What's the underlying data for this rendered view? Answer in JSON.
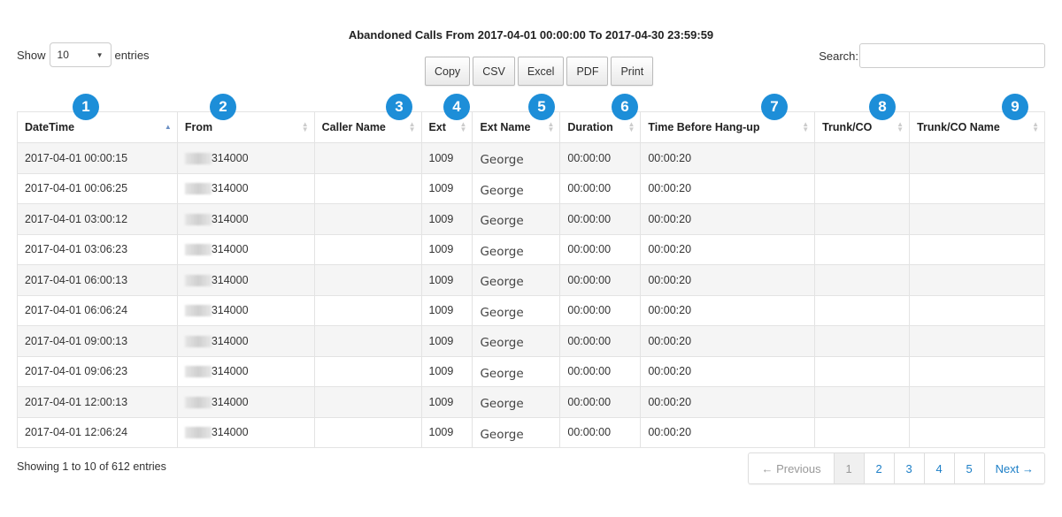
{
  "title": "Abandoned Calls From 2017-04-01 00:00:00 To 2017-04-30 23:59:59",
  "length": {
    "show_label": "Show",
    "value": "10",
    "entries_label": "entries"
  },
  "buttons": [
    "Copy",
    "CSV",
    "Excel",
    "PDF",
    "Print"
  ],
  "search": {
    "label": "Search:",
    "value": "",
    "placeholder": ""
  },
  "badge_color": "#1d8ed8",
  "columns": [
    {
      "label": "DateTime",
      "badge": "1",
      "sort": "asc"
    },
    {
      "label": "From",
      "badge": "2",
      "sort": "none"
    },
    {
      "label": "Caller Name",
      "badge": "3",
      "sort": "none"
    },
    {
      "label": "Ext",
      "badge": "4",
      "sort": "none"
    },
    {
      "label": "Ext Name",
      "badge": "5",
      "sort": "none"
    },
    {
      "label": "Duration",
      "badge": "6",
      "sort": "none"
    },
    {
      "label": "Time Before Hang-up",
      "badge": "7",
      "sort": "none"
    },
    {
      "label": "Trunk/CO",
      "badge": "8",
      "sort": "none"
    },
    {
      "label": "Trunk/CO Name",
      "badge": "9",
      "sort": "none"
    }
  ],
  "rows": [
    {
      "datetime": "2017-04-01 00:00:15",
      "from": "314000",
      "caller_name": "",
      "ext": "1009",
      "ext_name": "George",
      "duration": "00:00:00",
      "hangup": "00:00:20",
      "trunk": "",
      "trunk_name": ""
    },
    {
      "datetime": "2017-04-01 00:06:25",
      "from": "314000",
      "caller_name": "",
      "ext": "1009",
      "ext_name": "George",
      "duration": "00:00:00",
      "hangup": "00:00:20",
      "trunk": "",
      "trunk_name": ""
    },
    {
      "datetime": "2017-04-01 03:00:12",
      "from": "314000",
      "caller_name": "",
      "ext": "1009",
      "ext_name": "George",
      "duration": "00:00:00",
      "hangup": "00:00:20",
      "trunk": "",
      "trunk_name": ""
    },
    {
      "datetime": "2017-04-01 03:06:23",
      "from": "314000",
      "caller_name": "",
      "ext": "1009",
      "ext_name": "George",
      "duration": "00:00:00",
      "hangup": "00:00:20",
      "trunk": "",
      "trunk_name": ""
    },
    {
      "datetime": "2017-04-01 06:00:13",
      "from": "314000",
      "caller_name": "",
      "ext": "1009",
      "ext_name": "George",
      "duration": "00:00:00",
      "hangup": "00:00:20",
      "trunk": "",
      "trunk_name": ""
    },
    {
      "datetime": "2017-04-01 06:06:24",
      "from": "314000",
      "caller_name": "",
      "ext": "1009",
      "ext_name": "George",
      "duration": "00:00:00",
      "hangup": "00:00:20",
      "trunk": "",
      "trunk_name": ""
    },
    {
      "datetime": "2017-04-01 09:00:13",
      "from": "314000",
      "caller_name": "",
      "ext": "1009",
      "ext_name": "George",
      "duration": "00:00:00",
      "hangup": "00:00:20",
      "trunk": "",
      "trunk_name": ""
    },
    {
      "datetime": "2017-04-01 09:06:23",
      "from": "314000",
      "caller_name": "",
      "ext": "1009",
      "ext_name": "George",
      "duration": "00:00:00",
      "hangup": "00:00:20",
      "trunk": "",
      "trunk_name": ""
    },
    {
      "datetime": "2017-04-01 12:00:13",
      "from": "314000",
      "caller_name": "",
      "ext": "1009",
      "ext_name": "George",
      "duration": "00:00:00",
      "hangup": "00:00:20",
      "trunk": "",
      "trunk_name": ""
    },
    {
      "datetime": "2017-04-01 12:06:24",
      "from": "314000",
      "caller_name": "",
      "ext": "1009",
      "ext_name": "George",
      "duration": "00:00:00",
      "hangup": "00:00:20",
      "trunk": "",
      "trunk_name": ""
    }
  ],
  "info": "Showing 1 to 10 of 612 entries",
  "pagination": {
    "previous": "← Previous",
    "pages": [
      "1",
      "2",
      "3",
      "4",
      "5"
    ],
    "current": "1",
    "next": "Next →"
  }
}
